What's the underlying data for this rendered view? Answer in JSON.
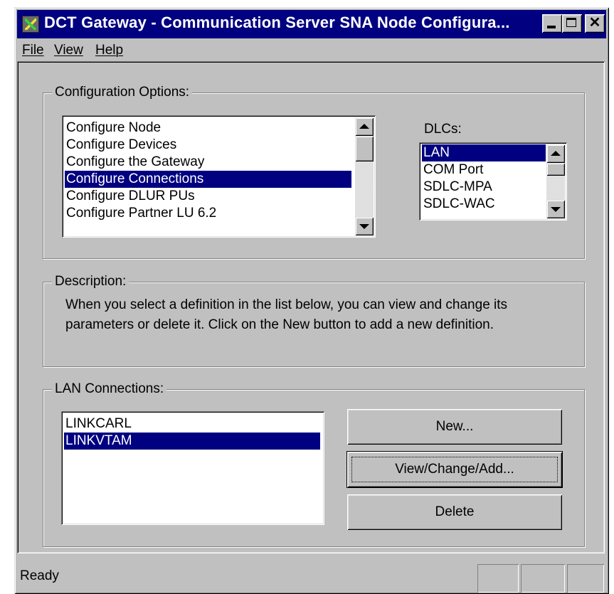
{
  "window": {
    "title": "DCT Gateway - Communication Server SNA Node Configura...",
    "controls": {
      "minimize": "minimize",
      "maximize": "maximize",
      "close": "✕"
    }
  },
  "menu": {
    "file": "File",
    "view": "View",
    "help": "Help"
  },
  "config_options": {
    "label": "Configuration Options:",
    "items": [
      "Configure Node",
      "Configure Devices",
      "Configure the Gateway",
      "Configure Connections",
      "Configure DLUR PUs",
      "Configure Partner LU 6.2"
    ],
    "selected_index": 3
  },
  "dlcs": {
    "label": "DLCs:",
    "items": [
      "LAN",
      "COM Port",
      "SDLC-MPA",
      "SDLC-WAC"
    ],
    "selected_index": 0
  },
  "description": {
    "label": "Description:",
    "text": "When you select a definition in the list below, you can view and change its parameters or delete it.  Click on the New button to add a new definition."
  },
  "lan_connections": {
    "label": "LAN Connections:",
    "items": [
      "LINKCARL",
      "LINKVTAM"
    ],
    "selected_index": 1,
    "buttons": {
      "new": "New...",
      "view_change_add": "View/Change/Add...",
      "delete": "Delete"
    }
  },
  "status_bar": {
    "text": "Ready"
  },
  "colors": {
    "titlebar": "#000080",
    "selection": "#000080",
    "face": "#c0c0c0"
  },
  "icons": [
    "app-icon",
    "minimize-icon",
    "maximize-icon",
    "close-icon",
    "scroll-up-icon",
    "scroll-down-icon"
  ]
}
